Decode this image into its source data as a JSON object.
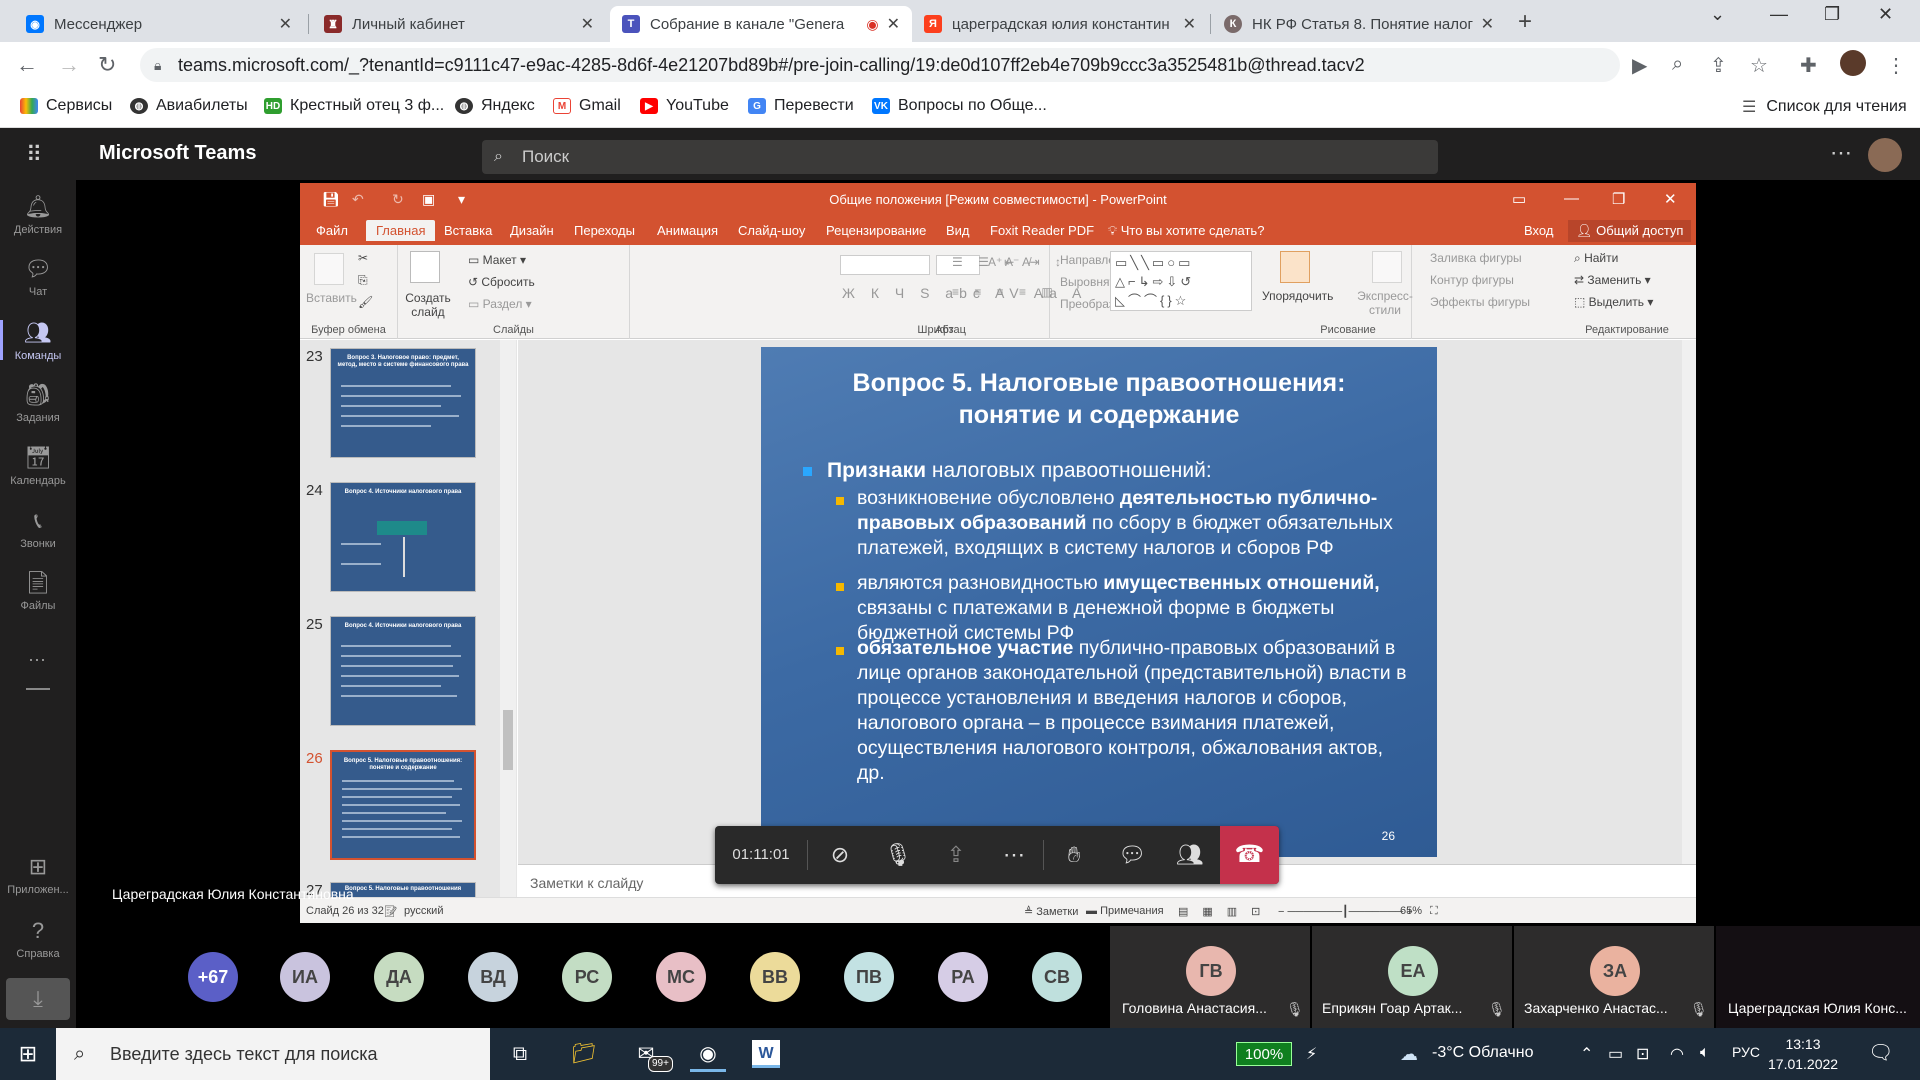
{
  "browser": {
    "tabs": [
      {
        "title": "Мессенджер",
        "icon_color": "#0077ff"
      },
      {
        "title": "Личный кабинет",
        "icon_color": "#8a2a2a"
      },
      {
        "title": "Собрание в канале \"Genera",
        "icon_color": "#4b53bc"
      },
      {
        "title": "цареградская юлия константин",
        "icon_color": "#fc3f1d"
      },
      {
        "title": "НК РФ Статья 8. Понятие налога",
        "icon_color": "#7a6a6a"
      }
    ],
    "url": "teams.microsoft.com/_?tenantId=c9111c47-e9ac-4285-8d6f-4e21207bd89b#/pre-join-calling/19:de0d107ff2eb4e709b9ccc3a3525481b@thread.tacv2",
    "bookmarks": [
      "Сервисы",
      "Авиабилеты",
      "Крестный отец 3 ф...",
      "Яндекс",
      "Gmail",
      "YouTube",
      "Перевести",
      "Вопросы по Обще..."
    ],
    "reading_list": "Список для чтения"
  },
  "teams": {
    "brand": "Microsoft Teams",
    "search_placeholder": "Поиск",
    "rail": [
      "Действия",
      "Чат",
      "Команды",
      "Задания",
      "Календарь",
      "Звонки",
      "Файлы",
      "Приложен...",
      "Справка"
    ],
    "presenter_name": "Цареградская Юлия Константиновна"
  },
  "ppt": {
    "title": "Общие положения [Режим совместимости] - PowerPoint",
    "menu": [
      "Файл",
      "Главная",
      "Вставка",
      "Дизайн",
      "Переходы",
      "Анимация",
      "Слайд-шоу",
      "Рецензирование",
      "Вид",
      "Foxit Reader PDF",
      "Что вы хотите сделать?"
    ],
    "signin": "Вход",
    "share": "Общий доступ",
    "ribbon": {
      "clipboard": "Буфер обмена",
      "paste": "Вставить",
      "slides": "Слайды",
      "layout": "Макет",
      "reset": "Сбросить",
      "new_slide": "Создать слайд",
      "section": "Раздел",
      "font": "Шрифт",
      "paragraph": "Абзац",
      "text_direction": "Направление текста",
      "align_text": "Выровнять текст",
      "smartart": "Преобразовать в SmartArt",
      "drawing": "Рисование",
      "arrange": "Упорядочить",
      "quick_styles": "Экспресс-стили",
      "shape_fill": "Заливка фигуры",
      "shape_outline": "Контур фигуры",
      "shape_effects": "Эффекты фигуры",
      "editing": "Редактирование",
      "find": "Найти",
      "replace": "Заменить",
      "select": "Выделить"
    },
    "thumbnails": [
      {
        "num": "23",
        "title": "Вопрос 3. Налоговое право: предмет, метод, место в системе финансового права"
      },
      {
        "num": "24",
        "title": "Вопрос 4. Источники налогового права"
      },
      {
        "num": "25",
        "title": "Вопрос 4. Источники налогового права"
      },
      {
        "num": "26",
        "title": "Вопрос 5. Налоговые правоотношения: понятие и содержание"
      },
      {
        "num": "27",
        "title": "Вопрос 5. Налоговые правоотношения"
      }
    ],
    "slide": {
      "title": "Вопрос 5. Налоговые правоотношения: понятие и содержание",
      "l1_bold": "Признаки",
      "l1_rest": "налоговых правоотношений:",
      "b1_pre": "возникновение обусловлено",
      "b1_bold": "деятельностью публично-правовых образований",
      "b1_post": "по сбору в бюджет обязательных платежей, входящих в систему налогов и сборов РФ",
      "b2_pre": "являются разновидностью",
      "b2_bold": "имущественных отношений,",
      "b2_post": "связаны с платежами в денежной форме в бюджеты бюджетной системы РФ",
      "b3_bold": "обязательное участие",
      "b3_post": "публично-правовых образований в лице органов законодательной (представительной) власти в процессе установления и введения налогов и сборов, налогового органа – в процессе взимания платежей, осуществления налогового контроля, обжалования актов, др.",
      "page": "26"
    },
    "notes_placeholder": "Заметки к слайду",
    "status": {
      "slide_of": "Слайд 26 из 32",
      "lang": "русский",
      "notes": "Заметки",
      "comments": "Примечания",
      "zoom": "65%"
    }
  },
  "call": {
    "timer": "01:11:01"
  },
  "participants": {
    "more": "+67",
    "avatars": [
      {
        "initials": "ИА",
        "color": "#c9c3de"
      },
      {
        "initials": "ДА",
        "color": "#c6dcc1"
      },
      {
        "initials": "ВД",
        "color": "#c7d3dd"
      },
      {
        "initials": "РС",
        "color": "#c3ddc4"
      },
      {
        "initials": "МС",
        "color": "#e8bfc6"
      },
      {
        "initials": "ВВ",
        "color": "#ecdb9a"
      },
      {
        "initials": "ПВ",
        "color": "#c3e2e3"
      },
      {
        "initials": "РА",
        "color": "#d6cde6"
      },
      {
        "initials": "СВ",
        "color": "#bfe0dd"
      }
    ],
    "tiles": [
      {
        "initials": "ГВ",
        "name": "Головина Анастасия...",
        "color": "#e8b7ae"
      },
      {
        "initials": "ЕА",
        "name": "Еприкян Гоар Артак...",
        "color": "#bfe0c6"
      },
      {
        "initials": "ЗА",
        "name": "Захарченко Анастас...",
        "color": "#eab29f"
      },
      {
        "initials": "",
        "name": "Цареградская Юлия Конс...",
        "color": ""
      }
    ]
  },
  "taskbar": {
    "search_placeholder": "Введите здесь текст для поиска",
    "mail_badge": "99+",
    "battery": "100%",
    "weather": "-3°C Облачно",
    "lang": "РУС",
    "time": "13:13",
    "date": "17.01.2022"
  }
}
